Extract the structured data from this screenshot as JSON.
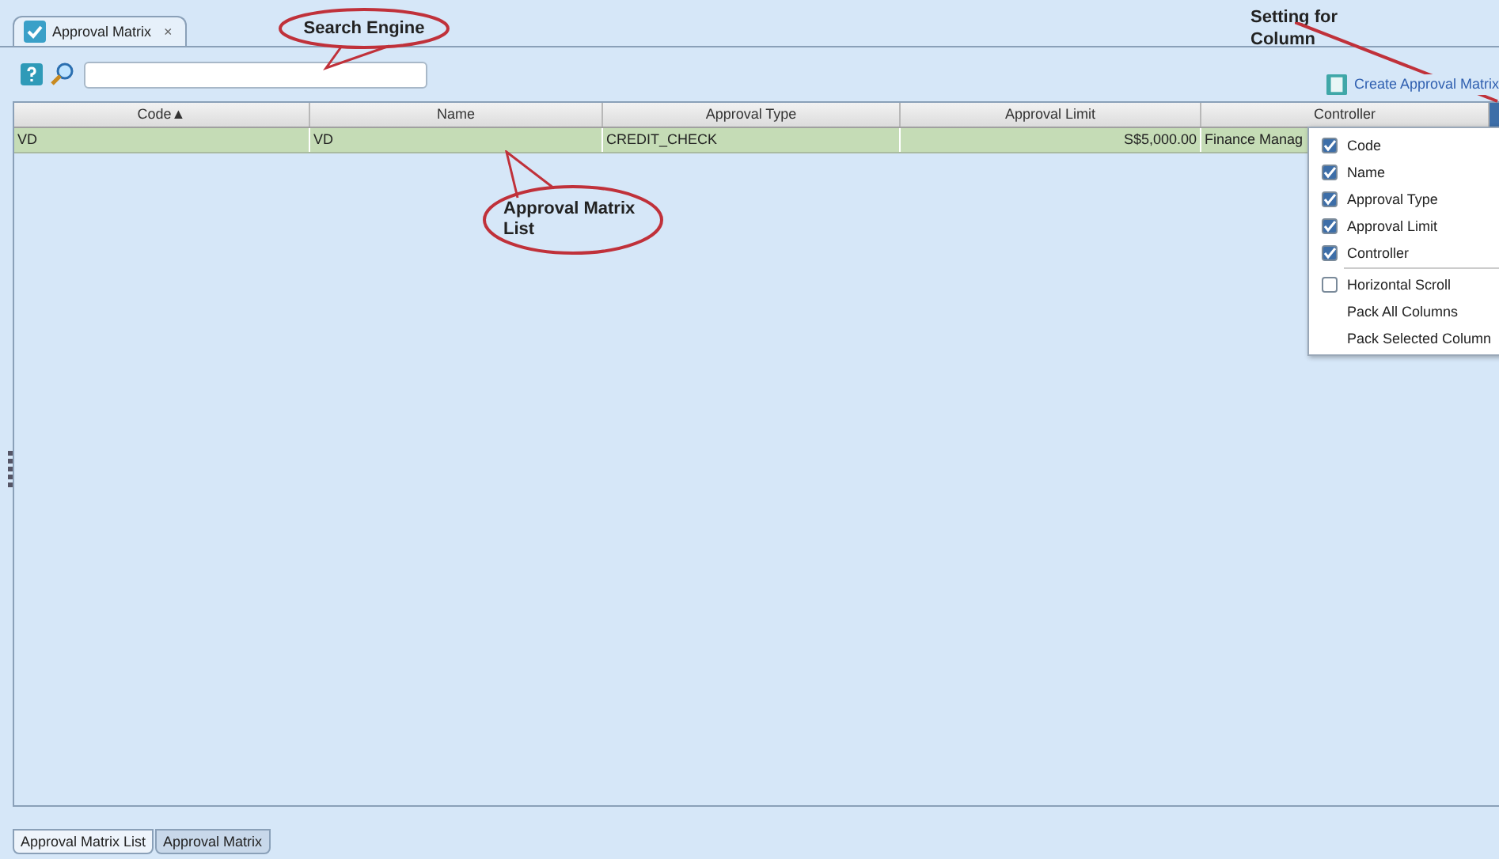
{
  "document_tab": {
    "label": "Approval Matrix",
    "close": "×",
    "selected": true
  },
  "toolbar": {
    "create_link": "Create Approval Matrix"
  },
  "table": {
    "columns": [
      {
        "label": "Code",
        "sort": "▲"
      },
      {
        "label": "Name"
      },
      {
        "label": "Approval Type"
      },
      {
        "label": "Approval Limit"
      },
      {
        "label": "Controller"
      }
    ],
    "rows": [
      {
        "cells": [
          "VD",
          "VD",
          "CREDIT_CHECK",
          "S$5,000.00",
          "Finance Manag"
        ],
        "selected": true
      }
    ]
  },
  "column_menu": [
    {
      "kind": "checkbox",
      "label": "Code",
      "checked": true
    },
    {
      "kind": "checkbox",
      "label": "Name",
      "checked": true
    },
    {
      "kind": "checkbox",
      "label": "Approval Type",
      "checked": true
    },
    {
      "kind": "checkbox",
      "label": "Approval Limit",
      "checked": true
    },
    {
      "kind": "checkbox",
      "label": "Controller",
      "checked": true
    },
    {
      "kind": "checkbox",
      "label": "Horizontal Scroll",
      "checked": false
    },
    {
      "kind": "action",
      "label": "Pack All Columns"
    },
    {
      "kind": "action",
      "label": "Pack Selected Column"
    }
  ],
  "callouts": [
    {
      "kind": "bubble",
      "text": "Search Engine"
    },
    {
      "kind": "bubble",
      "text": "Approval Matrix List"
    },
    {
      "kind": "arrow",
      "text": "Setting for Column"
    }
  ],
  "bottom_tabs": [
    {
      "label": "Approval Matrix List",
      "selected": true
    },
    {
      "label": "Approval Matrix",
      "selected": false
    }
  ]
}
